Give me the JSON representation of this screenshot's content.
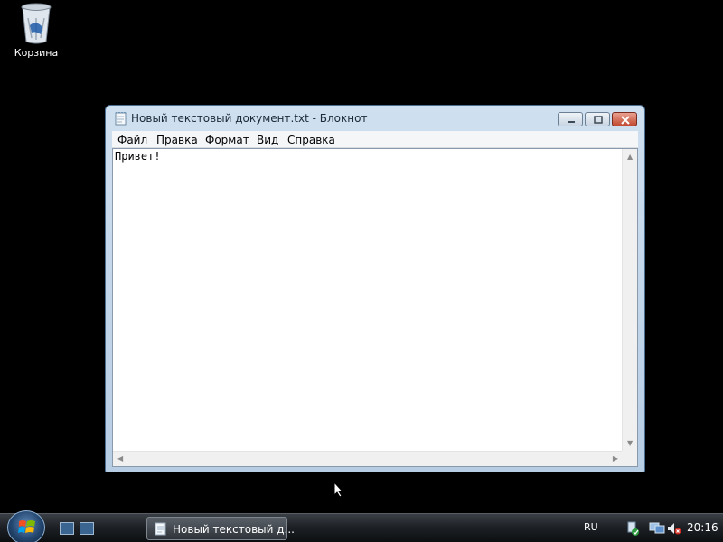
{
  "desktop": {
    "recycle_bin_label": "Корзина"
  },
  "window": {
    "title": "Новый текстовый документ.txt - Блокнот",
    "menu": [
      "Файл",
      "Правка",
      "Формат",
      "Вид",
      "Справка"
    ],
    "content": "Привет!"
  },
  "taskbar": {
    "task_label": "Новый текстовый д...",
    "language": "RU",
    "clock": "20:16"
  },
  "icons": {
    "start": "windows-orb-icon",
    "tray": [
      "network-icon",
      "monitor-network-icon",
      "volume-muted-icon"
    ]
  },
  "colors": {
    "desktop_background": "#000000",
    "window_frame": "#b7cde4",
    "close_button": "#c14a32"
  }
}
